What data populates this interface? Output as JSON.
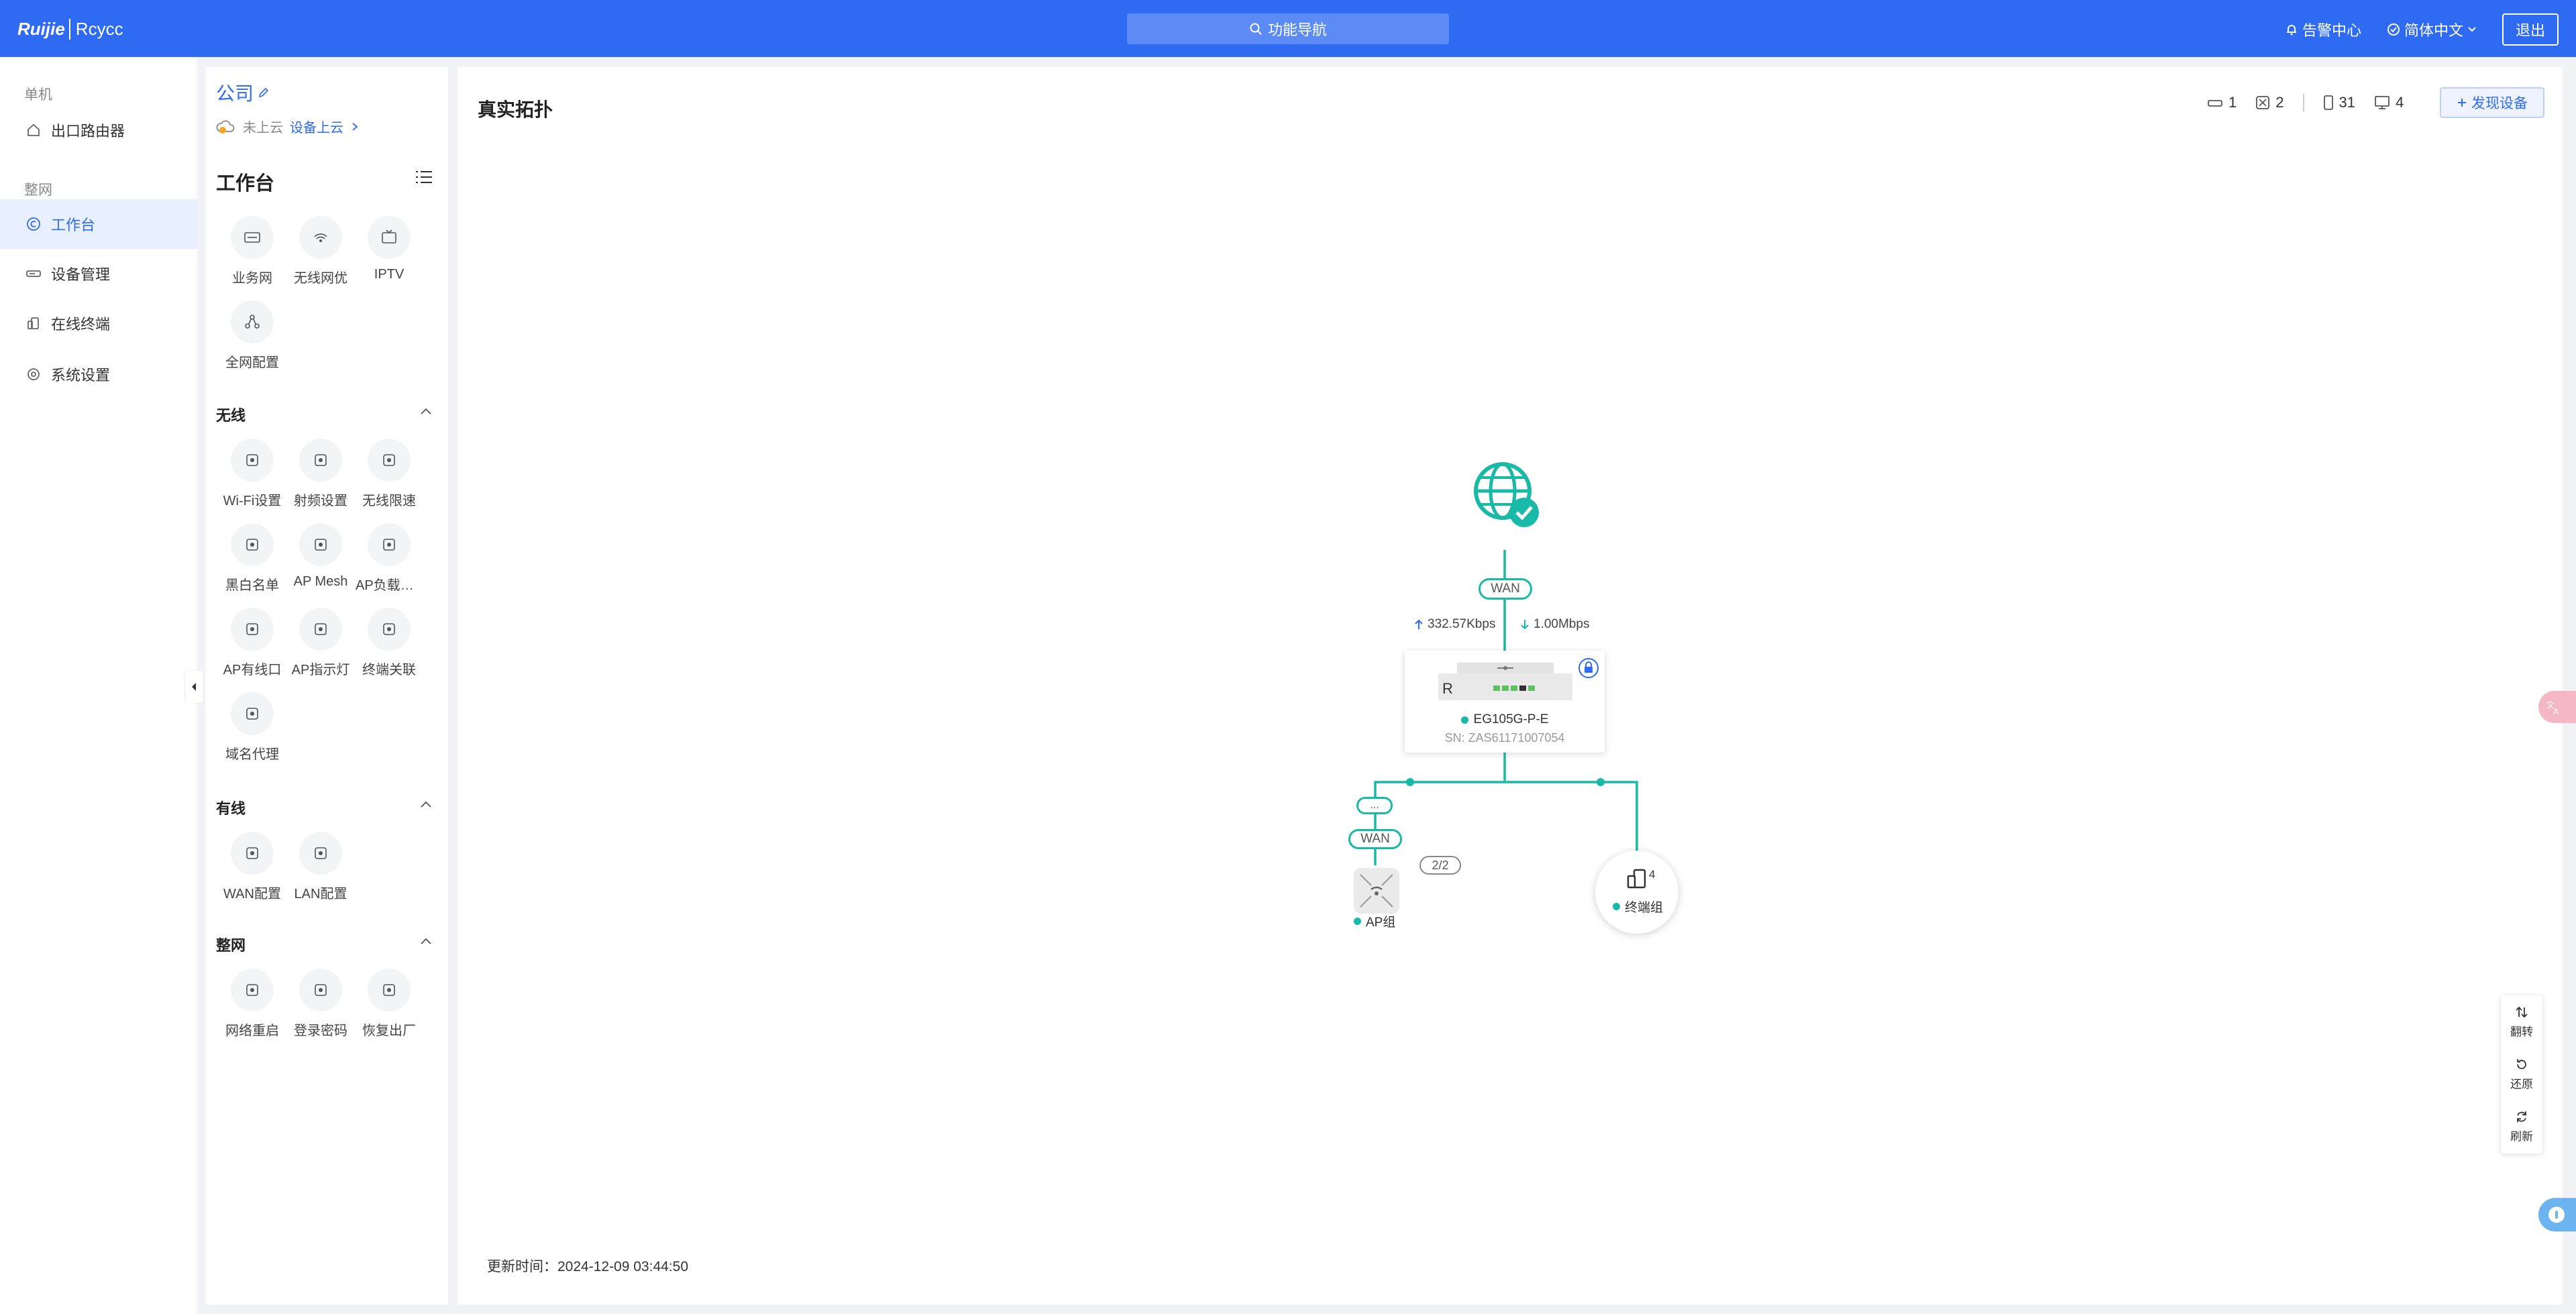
{
  "header": {
    "logo_text": "Ruijie",
    "logo_sub": "Rcycc",
    "search_label": "功能导航",
    "alerts_label": "告警中心",
    "language_label": "简体中文",
    "logout_label": "退出"
  },
  "leftnav": {
    "group_single": "单机",
    "item_router": "出口路由器",
    "group_whole": "整网",
    "item_workbench": "工作台",
    "item_devices": "设备管理",
    "item_terminals": "在线终端",
    "item_settings": "系统设置"
  },
  "workbench": {
    "company": "公司",
    "cloud_status": "未上云",
    "cloud_link": "设备上云",
    "title": "工作台",
    "tools_top": [
      "业务网",
      "无线网优",
      "IPTV",
      "全网配置"
    ],
    "section_wireless": "无线",
    "tools_wireless": [
      "Wi-Fi设置",
      "射频设置",
      "无线限速",
      "黑白名单",
      "AP Mesh",
      "AP负载均衡",
      "AP有线口",
      "AP指示灯",
      "终端关联",
      "域名代理"
    ],
    "section_wired": "有线",
    "tools_wired": [
      "WAN配置",
      "LAN配置"
    ],
    "section_network": "整网",
    "tools_network": [
      "网络重启",
      "登录密码",
      "恢复出厂"
    ]
  },
  "main": {
    "title": "真实拓扑",
    "stat_gateways": "1",
    "stat_aps": "2",
    "stat_clients": "31",
    "stat_terminals": "4",
    "discover_label": "发现设备",
    "update_label": "更新时间：",
    "update_time": "2024-12-09 03:44:50"
  },
  "topology": {
    "wan_label": "WAN",
    "upload_rate": "332.57Kbps",
    "download_rate": "1.00Mbps",
    "device_model": "EG105G-P-E",
    "device_sn": "SN: ZAS61171007054",
    "device_letter": "R",
    "ap_wan_label": "WAN",
    "ap_collapsed": "...",
    "ap_count": "2/2",
    "ap_group_label": "AP组",
    "terminal_count": "4",
    "terminal_group_label": "终端组"
  },
  "float_tools": {
    "flip": "翻转",
    "restore": "还原",
    "refresh": "刷新"
  },
  "colors": {
    "brand": "#2f6bf2",
    "teal": "#18b9a6"
  }
}
